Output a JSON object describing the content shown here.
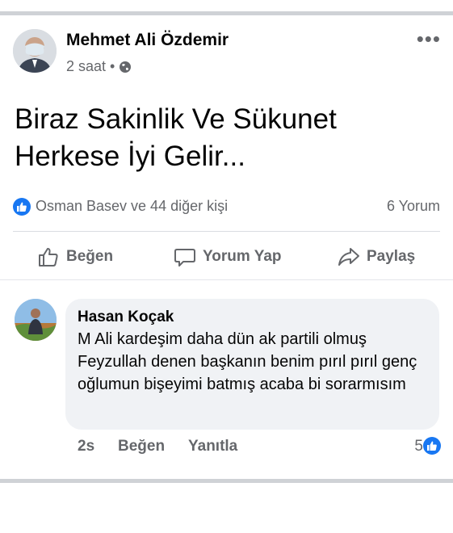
{
  "post": {
    "author": "Mehmet Ali Özdemir",
    "time": "2 saat",
    "dot": "•",
    "privacy_icon": "globe-icon",
    "more_icon": "•••",
    "text_line1": "Biraz Sakinlik Ve Sükunet",
    "text_line2": "Herkese İyi Gelir..."
  },
  "reactions": {
    "summary": "Osman Basev ve 44 diğer kişi",
    "comments": "6 Yorum",
    "icon": "like-icon"
  },
  "actions": {
    "like": "Beğen",
    "comment": "Yorum Yap",
    "share": "Paylaş"
  },
  "comment": {
    "author": "Hasan Koçak",
    "text": "M Ali kardeşim daha dün ak partili olmuş Feyzullah denen başkanın benim pırıl pırıl genç oğlumun bişeyimi batmış acaba bi sorarmısım",
    "time": "2s",
    "like": "Beğen",
    "reply": "Yanıtla",
    "reaction_count": "5"
  },
  "colors": {
    "accent": "#1877f2",
    "secondary_text": "#65676b",
    "bubble": "#f0f2f5"
  }
}
